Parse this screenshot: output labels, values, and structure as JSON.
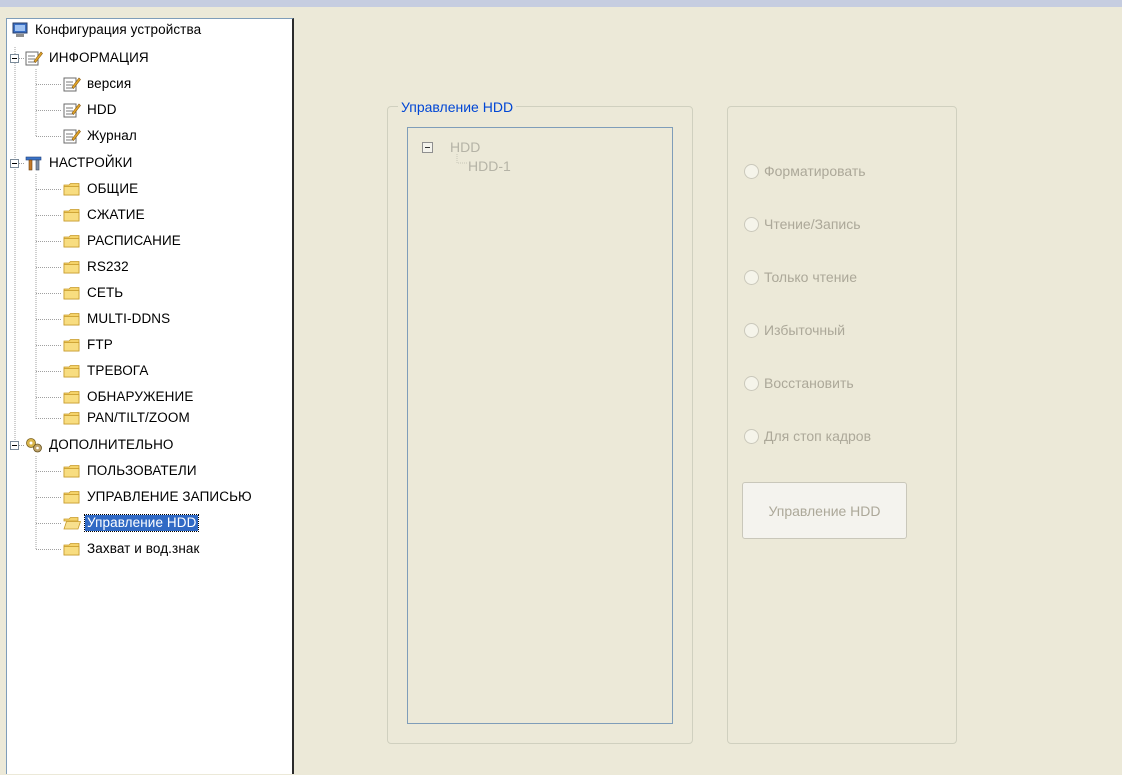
{
  "tree": {
    "root": "Конфигурация устройства",
    "info": {
      "label": "ИНФОРМАЦИЯ",
      "items": [
        "версия",
        "HDD",
        "Журнал"
      ]
    },
    "settings": {
      "label": "НАСТРОЙКИ",
      "items": [
        "ОБЩИЕ",
        "СЖАТИЕ",
        "РАСПИСАНИЕ",
        "RS232",
        "СЕТЬ",
        "MULTI-DDNS",
        "FTP",
        "ТРЕВОГА",
        "ОБНАРУЖЕНИЕ",
        "PAN/TILT/ZOOM"
      ]
    },
    "advanced": {
      "label": "ДОПОЛНИТЕЛЬНО",
      "items": [
        "ПОЛЬЗОВАТЕЛИ",
        "УПРАВЛЕНИЕ ЗАПИСЬЮ",
        "Управление HDD",
        "Захват и вод.знак"
      ],
      "selected_index": 2
    }
  },
  "panel": {
    "group_title": "Управление HDD",
    "hdd_tree": {
      "root": "HDD",
      "child": "HDD-1"
    },
    "options": [
      "Форматировать",
      "Чтение/Запись",
      "Только чтение",
      "Избыточный",
      "Восстановить",
      "Для стоп кадров"
    ],
    "button_label": "Управление HDD"
  },
  "colors": {
    "window_bg": "#ece9d8",
    "selection": "#316ac5",
    "legend_text": "#0046d5",
    "disabled_text": "#aca899"
  }
}
